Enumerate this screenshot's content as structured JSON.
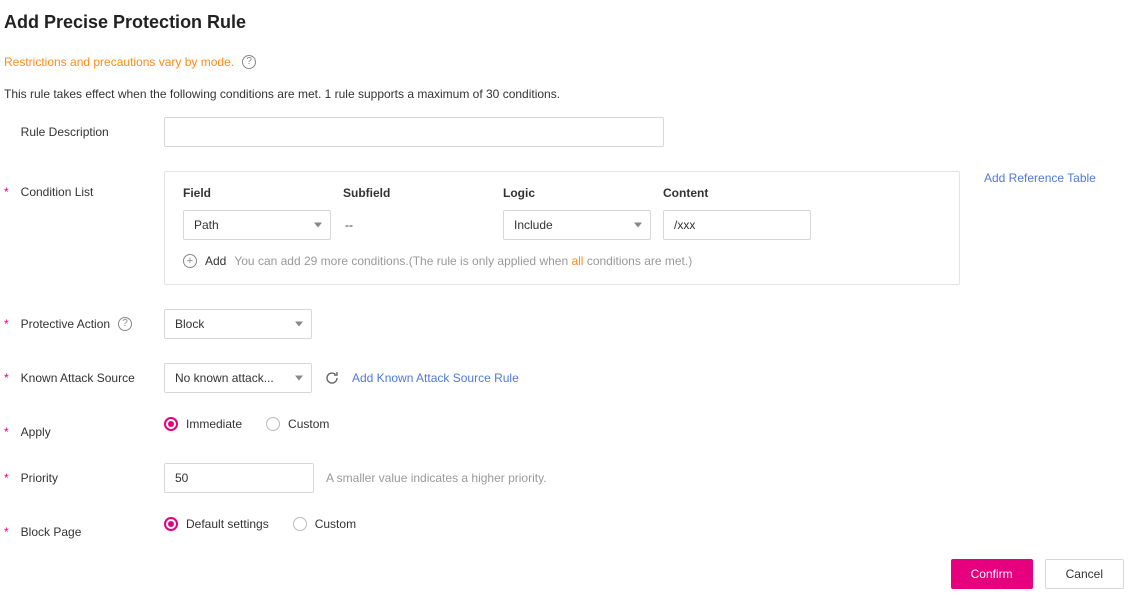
{
  "title": "Add Precise Protection Rule",
  "warn": "Restrictions and precautions vary by mode.",
  "info": "This rule takes effect when the following conditions are met. 1 rule supports a maximum of 30 conditions.",
  "labels": {
    "rule_description": "Rule Description",
    "condition_list": "Condition List",
    "protective_action": "Protective Action",
    "known_attack_source": "Known Attack Source",
    "apply": "Apply",
    "priority": "Priority",
    "block_page": "Block Page"
  },
  "condition_table": {
    "headers": {
      "field": "Field",
      "subfield": "Subfield",
      "logic": "Logic",
      "content": "Content"
    },
    "row": {
      "field_selected": "Path",
      "subfield_value": "--",
      "logic_selected": "Include",
      "content_value": "/xxx"
    },
    "add_label": "Add",
    "add_hint_pre": "You can add 29 more conditions.(The rule is only applied when ",
    "add_hint_em": "all",
    "add_hint_post": " conditions are met.)",
    "ref_link": "Add Reference Table"
  },
  "protective_action_selected": "Block",
  "known_attack_source": {
    "selected": "No known attack...",
    "add_link": "Add Known Attack Source Rule"
  },
  "apply_options": {
    "immediate": "Immediate",
    "custom": "Custom"
  },
  "priority": {
    "value": "50",
    "hint": "A smaller value indicates a higher priority."
  },
  "block_page_options": {
    "default_settings": "Default settings",
    "custom": "Custom"
  },
  "buttons": {
    "confirm": "Confirm",
    "cancel": "Cancel"
  },
  "rule_description_value": ""
}
